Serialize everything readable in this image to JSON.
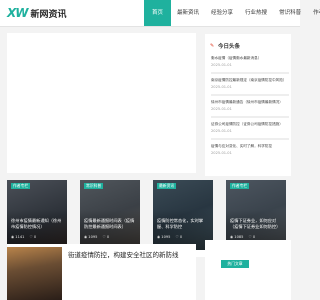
{
  "brand": {
    "mark": "XW",
    "name": "新网资讯",
    "accent": "#1fb19e"
  },
  "nav": [
    {
      "label": "首页",
      "active": true
    },
    {
      "label": "最新资讯",
      "active": false
    },
    {
      "label": "经验分享",
      "active": false
    },
    {
      "label": "行业热搜",
      "active": false
    },
    {
      "label": "常识科普",
      "active": false
    },
    {
      "label": "作者专栏",
      "active": false
    }
  ],
  "sidebar": {
    "title": "今日头条",
    "items": [
      {
        "title": "衡水疫情（疫情衡水最新消息）",
        "date": "2025-01-01"
      },
      {
        "title": "南京疫情防控最新规定（南京疫情防控中风险）",
        "date": "2025-01-01"
      },
      {
        "title": "徐州市疫情最新通告（徐州市疫情最新情况）",
        "date": "2025-01-01"
      },
      {
        "title": "证券公司疫情防控（证券公司疫情防控措施）",
        "date": "2025-01-01"
      },
      {
        "title": "疫情与应对变化、实时了解，科学防控",
        "date": "2025-01-01"
      }
    ]
  },
  "cards": [
    {
      "badge": "作者专栏",
      "title": "徐州市疫情最新通知（徐州市疫情防控情况）",
      "views": "1141",
      "likes": "0"
    },
    {
      "badge": "常识科普",
      "title": "疫情最新通报时间表（疫情防控最新通报时间表）",
      "views": "1095",
      "likes": "0"
    },
    {
      "badge": "最新资讯",
      "title": "疫情防控常态化，实时掌握、科学防控",
      "views": "1095",
      "likes": "0"
    },
    {
      "badge": "作者专栏",
      "title": "疫情下证券业，如何应对（疫情下证券业如何防控）",
      "views": "1085",
      "likes": "0"
    }
  ],
  "feature": {
    "title": "街道疫情防控，构建安全社区的新防线"
  },
  "lower_side": {
    "label": "热门文章"
  }
}
